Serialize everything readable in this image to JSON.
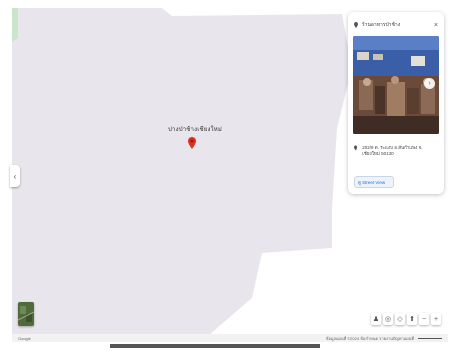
{
  "map": {
    "place_label": "ปางป่าช้างเชียงใหม่",
    "panel_toggle_icon": "chevron-left-icon"
  },
  "place_card": {
    "title": "ร้านอาหารป่าช้าง",
    "address": "202/9 ต. ระแงบ อ.สันกำแพง จ. เชียงใหม่ 50130",
    "street_view_label": "ดู Street View",
    "close_label": "×"
  },
  "footer": {
    "brand": "Google",
    "attribution": "ข้อมูลแผนที่ ©2024 ข้อกำหนด รายงานปัญหาแผนที่"
  },
  "colors": {
    "map_land": "#e8e6ec",
    "park_green": "#c8e6c9",
    "pin_red": "#d93025",
    "accent_blue": "#1a73e8"
  }
}
